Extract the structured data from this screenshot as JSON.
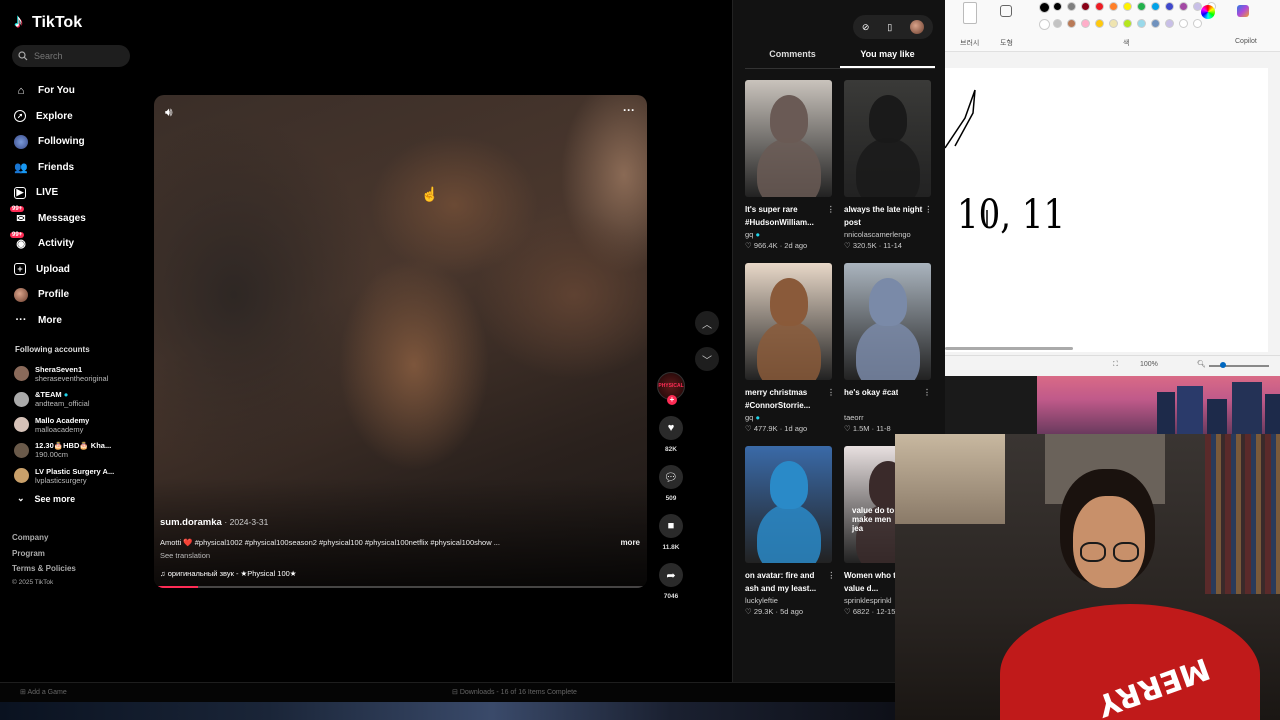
{
  "app": {
    "logo_text": "TikTok",
    "search_placeholder": "Search"
  },
  "sidebar": {
    "nav": [
      {
        "label": "For You",
        "icon": "home-icon"
      },
      {
        "label": "Explore",
        "icon": "compass-icon"
      },
      {
        "label": "Following",
        "icon": "following-avatar-icon"
      },
      {
        "label": "Friends",
        "icon": "friends-icon"
      },
      {
        "label": "LIVE",
        "icon": "live-icon"
      },
      {
        "label": "Messages",
        "icon": "messages-icon",
        "badge": "99+"
      },
      {
        "label": "Activity",
        "icon": "activity-icon",
        "badge": "99+"
      },
      {
        "label": "Upload",
        "icon": "upload-icon"
      },
      {
        "label": "Profile",
        "icon": "profile-avatar-icon"
      },
      {
        "label": "More",
        "icon": "more-icon"
      }
    ],
    "following_title": "Following accounts",
    "accounts": [
      {
        "name": "SheraSeven1",
        "handle": "sheraseventheoriginal",
        "color": "#8a6a5a"
      },
      {
        "name": "&TEAM",
        "handle": "andteam_official",
        "color": "#aaaaaa",
        "verified": true
      },
      {
        "name": "Mallo Academy",
        "handle": "malloacademy",
        "color": "#d6c2b8"
      },
      {
        "name": "12.30🎂HBD🎂 Kha...",
        "handle": "190.00cm",
        "color": "#6a5a4a"
      },
      {
        "name": "LV Plastic Surgery A...",
        "handle": "lvplasticsurgery",
        "color": "#c9a06a"
      }
    ],
    "see_more": "See more",
    "footer": [
      "Company",
      "Program",
      "Terms & Policies"
    ],
    "copyright": "© 2025 TikTok"
  },
  "video": {
    "author": "sum.doramka",
    "date": "2024-3-31",
    "description": "Amotti ❤️ #physical1002 #physical100season2 #physical100 #physical100netflix #physical100show ...",
    "more": "more",
    "see_translation": "See translation",
    "sound": "оригинальный звук - ★Physical 100★",
    "progress": 0.09
  },
  "actions": {
    "creator_badge": "PHYSICAL",
    "likes": "82K",
    "comments": "509",
    "saves": "11.8K",
    "shares": "7046"
  },
  "right_panel": {
    "tabs": [
      "Comments",
      "You may like"
    ],
    "active_tab": "You may like",
    "cards": [
      {
        "title": "It's super rare #HudsonWilliam...",
        "author": "gq",
        "verified": true,
        "likes": "966.4K",
        "age": "2d ago",
        "bg": "#c9c3bc",
        "fig": "#6a5a55"
      },
      {
        "title": "always the late night post",
        "author": "nnicolascamerlengo",
        "verified": false,
        "likes": "320.5K",
        "age": "11-14",
        "bg": "#3a3a38",
        "fig": "#1a1a1a"
      },
      {
        "title": "merry christmas #ConnorStorrie...",
        "author": "gq",
        "verified": true,
        "likes": "477.9K",
        "age": "1d ago",
        "bg": "#e8d8c8",
        "fig": "#8a5a3a"
      },
      {
        "title": "he's okay #cat",
        "author": "taeorr",
        "verified": false,
        "likes": "1.5M",
        "age": "11-8",
        "bg": "#aab4be",
        "fig": "#7a8aa8"
      },
      {
        "title": "on avatar: fire and ash and my least...",
        "author": "luckyleftie",
        "verified": false,
        "likes": "29.3K",
        "age": "5d ago",
        "bg": "#3a6aa8",
        "fig": "#2a8ac8"
      },
      {
        "title": "Women who their value d...",
        "author": "sprinklesprinkl",
        "verified": false,
        "likes": "6822",
        "age": "12-15",
        "bg": "#e8e0e0",
        "fig": "#3a2a2a",
        "overlay": "value do to make men jea"
      }
    ]
  },
  "paint": {
    "tool_labels": [
      "브러시",
      "도형",
      "색"
    ],
    "copilot": "Copilot",
    "zoom": "100%",
    "drawing_text": "10, 11"
  },
  "taskbar": {
    "left": "Add a Game",
    "center": "Downloads - 16 of 16 Items Complete"
  }
}
